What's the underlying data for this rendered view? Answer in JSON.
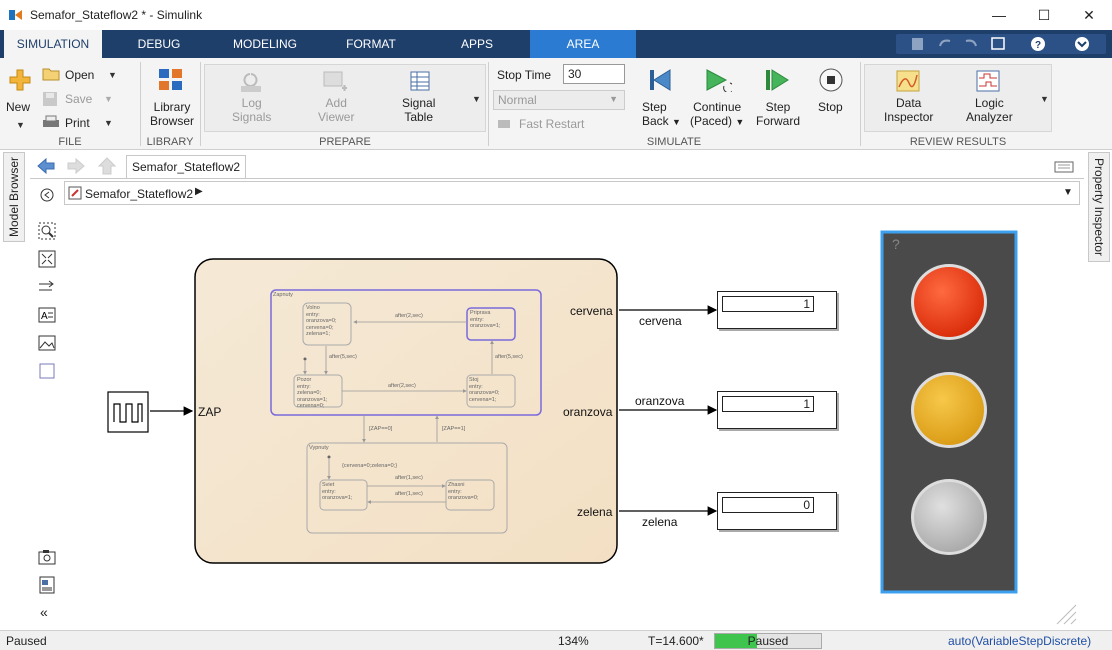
{
  "window": {
    "title": "Semafor_Stateflow2 * - Simulink",
    "minimize": "—",
    "maximize": "☐",
    "close": "✕"
  },
  "tabs": [
    "SIMULATION",
    "DEBUG",
    "MODELING",
    "FORMAT",
    "APPS",
    "AREA"
  ],
  "ribbon": {
    "file": {
      "new": "New",
      "open": "Open",
      "save": "Save",
      "print": "Print",
      "title": "FILE"
    },
    "library": {
      "browser_line1": "Library",
      "browser_line2": "Browser",
      "title": "LIBRARY"
    },
    "prepare": {
      "log_line1": "Log",
      "log_line2": "Signals",
      "add_line1": "Add",
      "add_line2": "Viewer",
      "signal_line1": "Signal",
      "signal_line2": "Table",
      "title": "PREPARE"
    },
    "simulate": {
      "stop_time_label": "Stop Time",
      "stop_time_value": "30",
      "mode": "Normal",
      "fast_restart": "Fast Restart",
      "step_back_line1": "Step",
      "step_back_line2": "Back",
      "continue_line1": "Continue",
      "continue_line2": "(Paced)",
      "step_fwd_line1": "Step",
      "step_fwd_line2": "Forward",
      "stop": "Stop",
      "title": "SIMULATE"
    },
    "review": {
      "data_line1": "Data",
      "data_line2": "Inspector",
      "logic_line1": "Logic",
      "logic_line2": "Analyzer",
      "title": "REVIEW RESULTS"
    }
  },
  "editor": {
    "doc_tab": "Semafor_Stateflow2",
    "breadcrumb": "Semafor_Stateflow2",
    "left_side_tab": "Model Browser",
    "right_side_tab": "Property Inspector"
  },
  "diagram": {
    "input_label": "ZAP",
    "outputs": [
      {
        "port": "cervena",
        "line": "cervena",
        "value": "1"
      },
      {
        "port": "oranzova",
        "line": "oranzova",
        "value": "1"
      },
      {
        "port": "zelena",
        "line": "zelena",
        "value": "0"
      }
    ],
    "states": {
      "zapnuty": "Zapnuty",
      "volno": [
        "Volno",
        "entry:",
        "oranzova=0;",
        "cervena=0;",
        "zelena=1;"
      ],
      "priprava": [
        "Priprava",
        "entry:",
        "oranzova=1;"
      ],
      "pozor": [
        "Pozor",
        "entry:",
        "zelena=0;",
        "oranzova=1;",
        "cervena=0;"
      ],
      "stoj": [
        "Stoj",
        "entry:",
        "oranzova=0;",
        "cervena=1;"
      ],
      "vypnuty": "Vypnuty",
      "svieti": [
        "Sviet",
        "entry:",
        "oranzova=1;"
      ],
      "zhasni": [
        "Zhasni",
        "entry:",
        "oranzova=0;"
      ]
    },
    "transitions": {
      "volno_priprava": "after(2,sec)",
      "volno_pozor": "after(5,sec)",
      "pozor_stoj": "after(2,sec)",
      "stoj_priprava": "after(5,sec)",
      "zap0": "[ZAP==0]",
      "zap1": "[ZAP==1]",
      "vyp_default": "{cervena=0;zelena=0;}",
      "svieti_zhasni": "after(1,sec)",
      "zhasni_svieti": "after(1,sec)"
    },
    "lamp_help": "?"
  },
  "lamp": {
    "red": "#ee3a10",
    "amber": "#eeb120",
    "off": "#c8c8c8"
  },
  "status": {
    "state": "Paused",
    "zoom": "134%",
    "time": "T=14.600*",
    "progress_label": "Paused",
    "progress": 0.4,
    "solver": "auto(VariableStepDiscrete)"
  }
}
